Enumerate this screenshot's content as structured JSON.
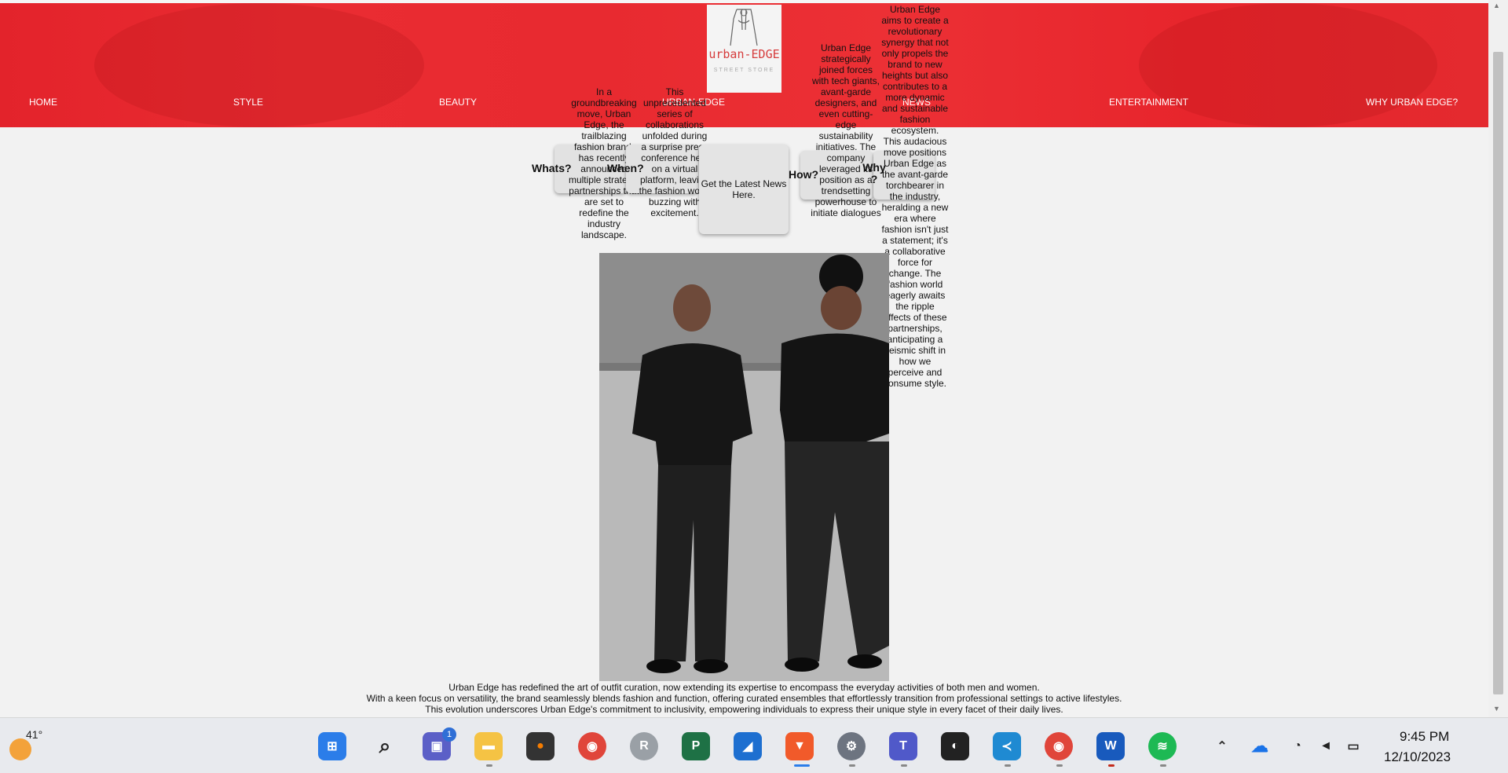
{
  "brand": {
    "logo_text": "urban-EDGE",
    "logo_tagline": "STREET STORE",
    "center_label": "URBAN-EDGE"
  },
  "nav": {
    "items": [
      "HOME",
      "STYLE",
      "BEAUTY",
      "NEWS",
      "ENTERTAINMENT",
      "WHY URBAN EDGE?"
    ]
  },
  "cards": {
    "whats": {
      "title": "Whats?",
      "text": "In a groundbreaking move, Urban Edge, the trailblazing fashion brand, has recently announced multiple strategic partnerships that are set to redefine the industry landscape."
    },
    "when": {
      "title": "When?",
      "text": "This unprecedented series of collaborations unfolded during a surprise press conference held on a virtual platform, leaving the fashion world buzzing with excitement."
    },
    "how": {
      "title": "How?",
      "text": "Urban Edge strategically joined forces with tech giants, avant-garde designers, and even cutting-edge sustainability initiatives. The company leveraged its position as a trendsetting powerhouse to initiate dialogues"
    },
    "why": {
      "title": "Why ?",
      "text": "Urban Edge aims to create a revolutionary synergy that not only propels the brand to new heights but also contributes to a more dynamic and sustainable fashion ecosystem. This audacious move positions Urban Edge as the avant-garde torchbearer in the industry, heralding a new era where fashion isn't just a statement; it's a collaborative force for change. The fashion world eagerly awaits the ripple effects of these partnerships, anticipating a seismic shift in how we perceive and consume style."
    }
  },
  "news_button": "Get the Latest News Here.",
  "footer": {
    "line1": "Urban Edge has redefined the art of outfit curation, now extending its expertise to encompass the everyday activities of both men and women.",
    "line2": "With a keen focus on versatility, the brand seamlessly blends fashion and function, offering curated ensembles that effortlessly transition from professional settings to active lifestyles.",
    "line3": "This evolution underscores Urban Edge's commitment to inclusivity, empowering individuals to express their unique style in every facet of their daily lives."
  },
  "taskbar": {
    "weather_temp": "41°",
    "chat_badge": "1",
    "time": "9:45 PM",
    "date": "12/10/2023",
    "icons": [
      "weather-icon",
      "start-icon",
      "search-icon",
      "chat-icon",
      "file-explorer-icon",
      "fl-studio-icon",
      "chrome-icon",
      "r-icon",
      "project-icon",
      "wireshark-icon",
      "brave-icon",
      "settings-icon",
      "teams-icon",
      "imvu-icon",
      "vscode-icon",
      "chrome-profile-icon",
      "word-icon",
      "spotify-icon",
      "chevron-up-icon",
      "onedrive-icon",
      "wifi-icon",
      "volume-icon",
      "battery-icon"
    ]
  },
  "colors": {
    "hero_red": "#e82a30",
    "page_bg": "#f2f2f2",
    "taskbar_bg": "#e8eaee"
  }
}
